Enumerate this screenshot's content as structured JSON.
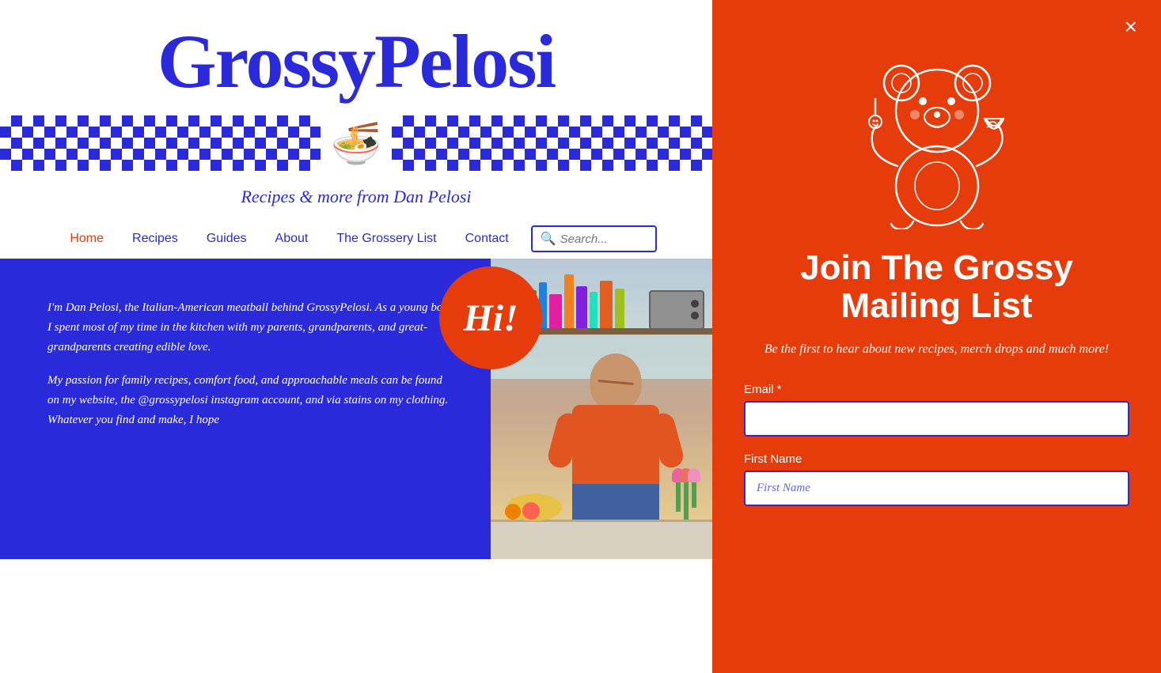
{
  "site": {
    "title": "GrossyPelosi",
    "subtitle": "Recipes & more from Dan Pelosi"
  },
  "nav": {
    "items": [
      {
        "id": "home",
        "label": "Home",
        "active": true
      },
      {
        "id": "recipes",
        "label": "Recipes",
        "active": false
      },
      {
        "id": "guides",
        "label": "Guides",
        "active": false
      },
      {
        "id": "about",
        "label": "About",
        "active": false
      },
      {
        "id": "grossery-list",
        "label": "The Grossery List",
        "active": false
      },
      {
        "id": "contact",
        "label": "Contact",
        "active": false
      }
    ],
    "search_placeholder": "Search..."
  },
  "hero": {
    "hi_badge": "Hi!",
    "paragraph1": "I'm Dan Pelosi, the Italian-American meatball behind GrossyPelosi. As a young boy, I spent most of my time in the kitchen with my parents, grandparents, and great-grandparents creating edible love.",
    "paragraph2": "My passion for family recipes, comfort food, and approachable meals can be found on my website, the @grossypelosi instagram account, and via stains on my clothing. Whatever you find and make, I hope"
  },
  "panel": {
    "close_label": "×",
    "join_title": "Join The Grossy Mailing List",
    "join_subtitle": "Be the first to hear about new recipes, merch drops and much more!",
    "email_label": "Email *",
    "email_placeholder": "",
    "firstname_label": "First Name",
    "firstname_placeholder": "First Name"
  },
  "colors": {
    "blue": "#2a2adb",
    "orange": "#e63b0a",
    "white": "#ffffff"
  }
}
